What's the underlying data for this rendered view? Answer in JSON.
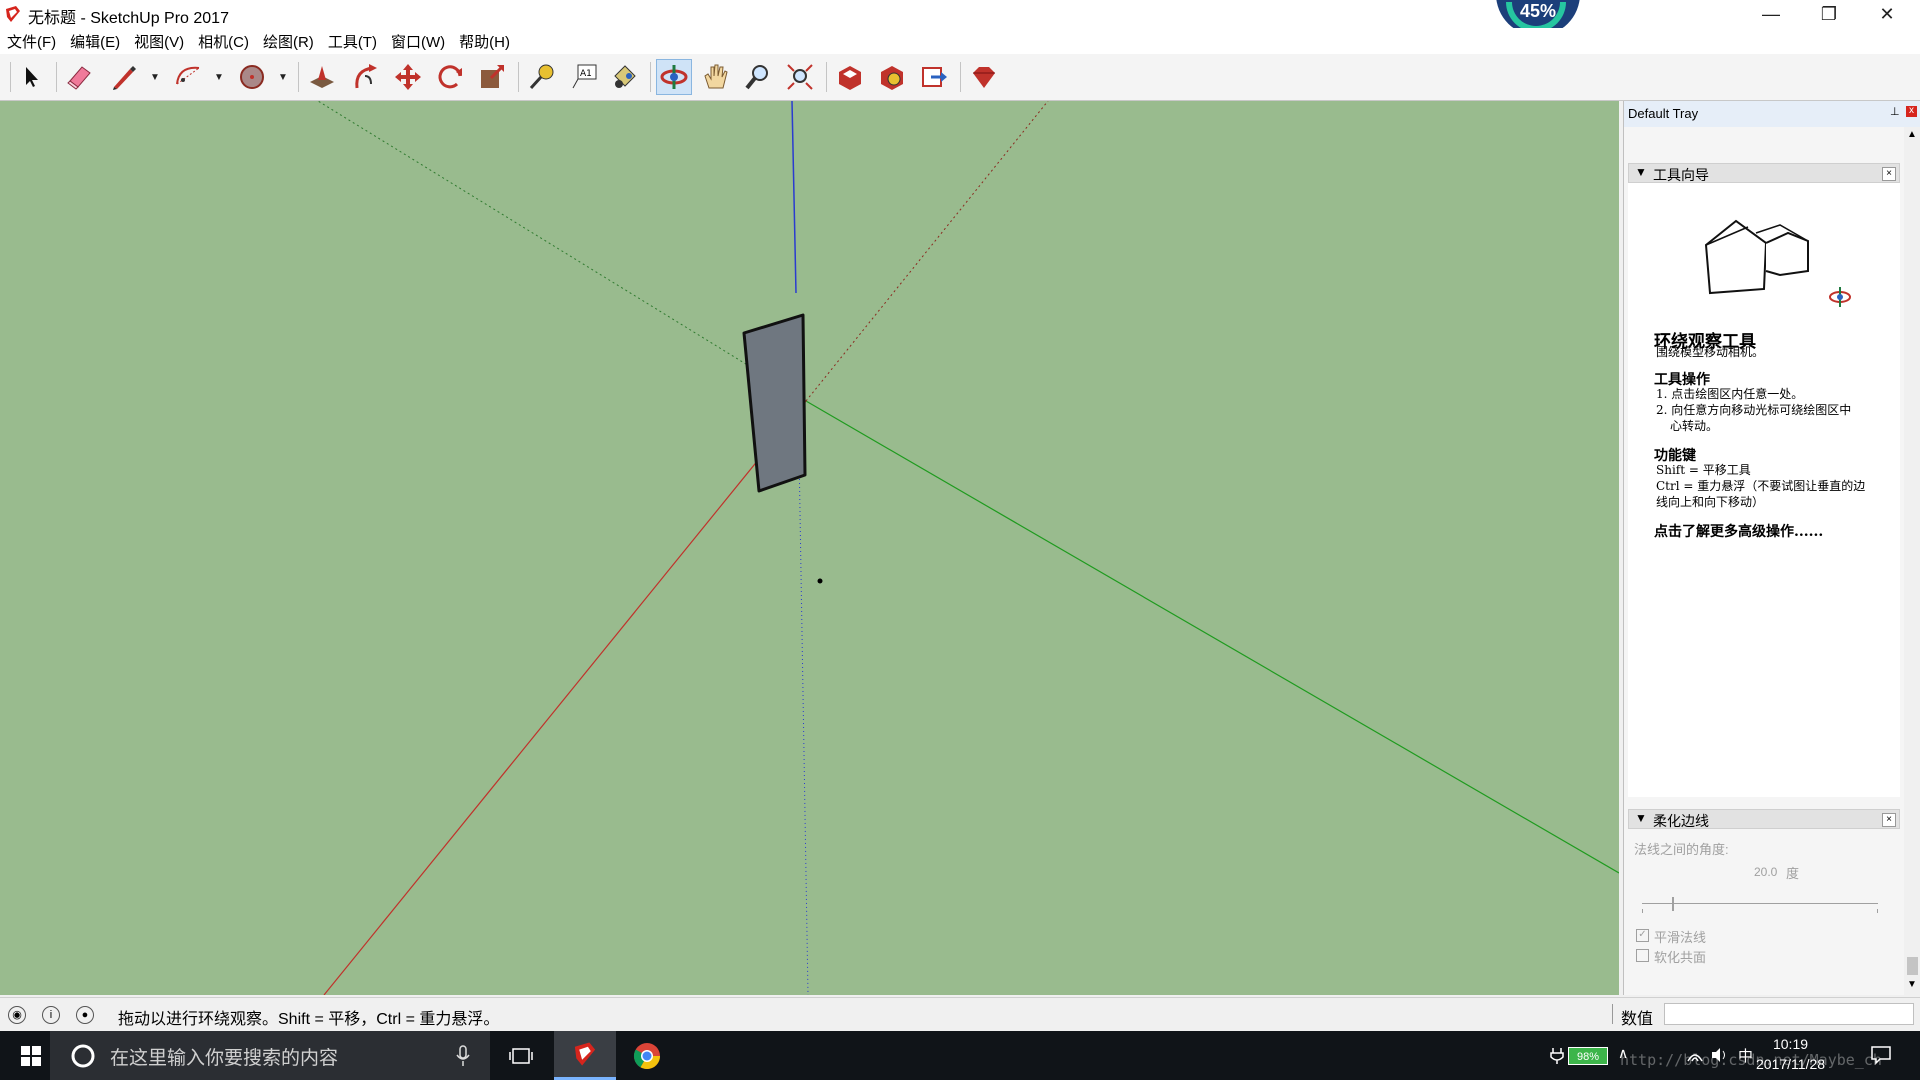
{
  "window": {
    "title": "无标题 - SketchUp Pro 2017",
    "minimize_glyph": "—",
    "restore_glyph": "❐",
    "close_glyph": "✕",
    "badge_text": "45%"
  },
  "menu": [
    "文件(F)",
    "编辑(E)",
    "视图(V)",
    "相机(C)",
    "绘图(R)",
    "工具(T)",
    "窗口(W)",
    "帮助(H)"
  ],
  "toolbar": {
    "tools": [
      "select",
      "eraser",
      "line",
      "arc",
      "shapes",
      "push-pull",
      "follow-me",
      "move",
      "rotate",
      "scale",
      "tape-measure",
      "text",
      "paint-bucket",
      "orbit",
      "pan",
      "zoom",
      "zoom-extents",
      "warehouse",
      "extension-warehouse",
      "send-to-layout",
      "ruby"
    ],
    "active_tool": "orbit"
  },
  "tray": {
    "title": "Default Tray",
    "pin_glyph": "⊥",
    "close_glyph": "x",
    "instructor": {
      "header": "工具向导",
      "tool_name": "环绕观察工具",
      "tool_desc": "围绕模型移动相机。",
      "ops_title": "工具操作",
      "ops": [
        "1. 点击绘图区内任意一处。",
        "2. 向任意方向移动光标可绕绘图区中",
        "心转动。"
      ],
      "keys_title": "功能键",
      "keys": [
        "Shift = 平移工具",
        "Ctrl = 重力悬浮（不要试图让垂直的边",
        "线向上和向下移动）"
      ],
      "more_link": "点击了解更多高级操作......"
    },
    "soften": {
      "header": "柔化边线",
      "angle_label": "法线之间的角度:",
      "angle_value": "20.0",
      "angle_unit": "度",
      "smooth_normals": "平滑法线",
      "soften_coplanar": "软化共面",
      "smooth_checked": true,
      "coplanar_checked": false
    }
  },
  "status": {
    "message": "拖动以进行环绕观察。Shift = 平移，Ctrl = 重力悬浮。",
    "measure_label": "数值",
    "measure_value": ""
  },
  "taskbar": {
    "search_placeholder": "在这里输入你要搜索的内容",
    "time": "10:19",
    "date": "2017/11/28",
    "battery": "98%",
    "ime": "中",
    "watermark": "http://blog.csdn.net/Maybe_ch"
  },
  "colors": {
    "viewport_bg": "#99bb8e",
    "red_axis": "#c0322b",
    "green_axis": "#1f9b1f",
    "blue_axis": "#2a3bd0",
    "face": "#6f7780",
    "taskbar_bg": "#101418"
  }
}
